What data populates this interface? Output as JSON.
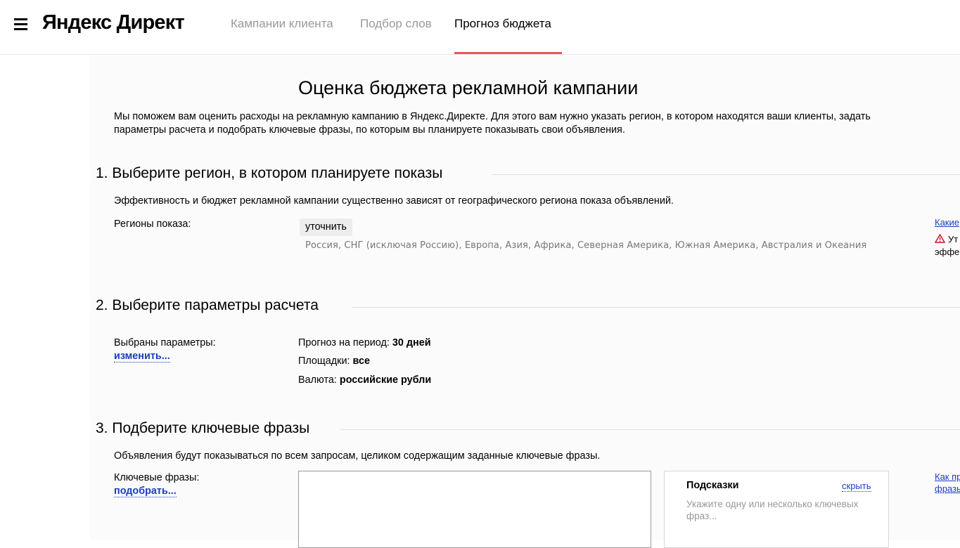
{
  "header": {
    "logo": "Яндекс Директ",
    "tabs": [
      {
        "label": "Кампании клиента",
        "active": false
      },
      {
        "label": "Подбор слов",
        "active": false
      },
      {
        "label": "Прогноз бюджета",
        "active": true
      }
    ],
    "accent_color": "#f0535b"
  },
  "main": {
    "title": "Оценка бюджета рекламной кампании",
    "intro": "Мы поможем вам оценить расходы на рекламную кампанию в Яндекс.Директе. Для этого вам нужно указать регион, в котором находятся ваши клиенты, задать параметры расчета и подобрать ключевые фразы, по которым вы планируете показывать свои объявления.",
    "section1": {
      "heading": "1. Выберите регион, в котором планируете показы",
      "description": "Эффективность и бюджет рекламной кампании существенно зависят от географического региона показа объявлений.",
      "regions_label": "Регионы показа:",
      "clarify_button": "уточнить",
      "regions_list": "Россия, СНГ (исключая Россию), Европа, Азия, Африка, Северная Америка, Южная Америка, Австралия и Океания",
      "side_link": "Какие",
      "warning_line1": "Ут",
      "warning_line2": "эффе"
    },
    "section2": {
      "heading": "2. Выберите параметры расчета",
      "selected_label": "Выбраны параметры:",
      "change_link": "изменить...",
      "params": [
        {
          "label": "Прогноз на период:",
          "value": "30 дней"
        },
        {
          "label": "Площадки:",
          "value": "все"
        },
        {
          "label": "Валюта:",
          "value": "российские рубли"
        }
      ]
    },
    "section3": {
      "heading": "3. Подберите ключевые фразы",
      "description": "Объявления будут показываться по всем запросам, целиком содержащим заданные ключевые фразы.",
      "keywords_label": "Ключевые фразы:",
      "pick_link": "подобрать...",
      "keywords_value": "",
      "hints": {
        "title": "Подсказки",
        "hide_link": "скрыть",
        "text": "Укажите одну или несколько ключевых фраз..."
      },
      "side_link_line1": "Как пр",
      "side_link_line2": "фразы"
    }
  }
}
